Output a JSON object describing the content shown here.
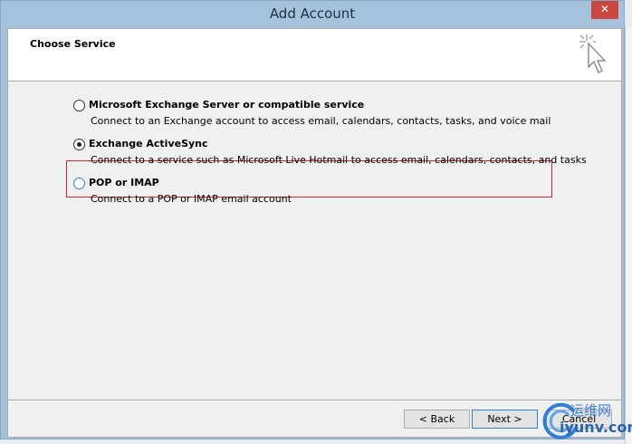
{
  "window": {
    "title": "Add Account",
    "close_glyph": "✕"
  },
  "header": {
    "title": "Choose Service",
    "icon": "cursor-click-icon"
  },
  "options": [
    {
      "label": "Microsoft Exchange Server or compatible service",
      "description": "Connect to an Exchange account to access email, calendars, contacts, tasks, and voice mail",
      "selected": false
    },
    {
      "label": "Exchange ActiveSync",
      "description": "Connect to a service such as Microsoft Live Hotmail to access email, calendars, contacts, and tasks",
      "selected": true
    },
    {
      "label": "POP or IMAP",
      "description": "Connect to a POP or IMAP email account",
      "selected": false
    }
  ],
  "buttons": {
    "back": "< Back",
    "next": "Next >",
    "cancel": "Cancel"
  },
  "watermark": {
    "cn": "运维网",
    "en": "iyunv.com"
  },
  "colors": {
    "highlight": "#d9262a",
    "focus": "#2f7fd6"
  }
}
